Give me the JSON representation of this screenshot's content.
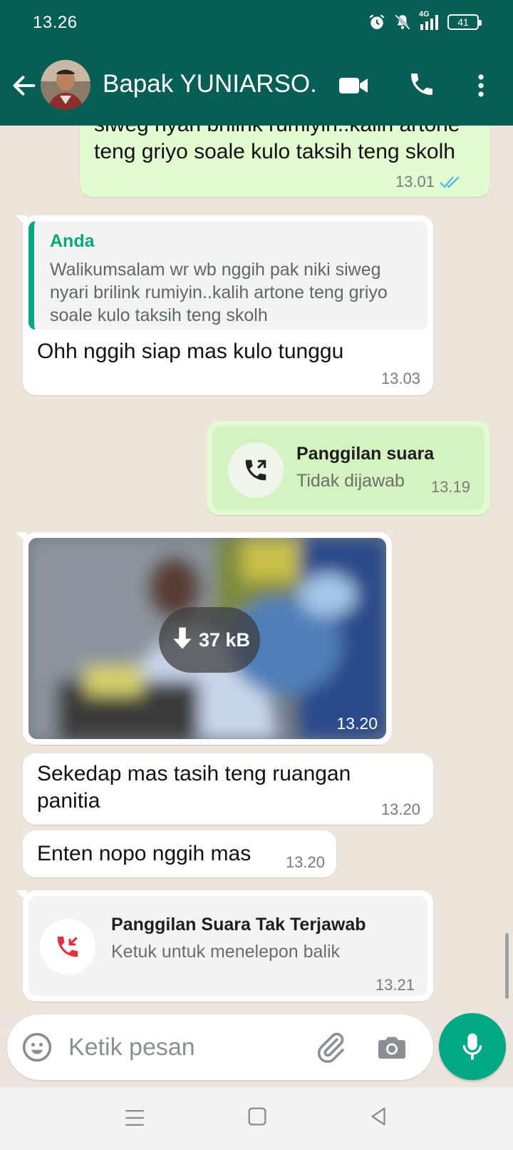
{
  "status_bar": {
    "time": "13.26",
    "network": "4G",
    "battery": "41",
    "icons": [
      "alarm-icon",
      "mute-icon",
      "signal-icon",
      "battery-icon"
    ]
  },
  "header": {
    "contact_name": "Bapak YUNIARSO...",
    "actions": [
      "back-arrow-icon",
      "video-call-icon",
      "phone-icon",
      "more-vert-icon"
    ]
  },
  "colors": {
    "header": "#075e54",
    "outgoing_bubble": "#e2fbd1",
    "incoming_bubble": "#ffffff",
    "accent": "#00a884",
    "missed_call": "#e0323c",
    "read_ticks": "#53bdeb"
  },
  "messages": [
    {
      "direction": "out",
      "text": "siweg nyari brilink rumiyin..kalih artone teng griyo soale kulo taksih teng skolh",
      "time": "13.01",
      "status": "read"
    },
    {
      "direction": "in",
      "quote_author": "Anda",
      "quote_text": "Walikumsalam wr wb nggih pak niki siweg nyari brilink rumiyin..kalih artone teng griyo soale kulo taksih teng skolh",
      "text": "Ohh nggih siap mas kulo tunggu",
      "time": "13.03"
    },
    {
      "direction": "out",
      "call_title": "Panggilan suara",
      "call_status": "Tidak dijawab",
      "time": "13.19"
    },
    {
      "direction": "in",
      "type": "image",
      "download_size": "37 kB",
      "time": "13.20"
    },
    {
      "direction": "in",
      "text": "Sekedap mas tasih teng ruangan panitia",
      "time": "13.20"
    },
    {
      "direction": "in",
      "text": "Enten nopo nggih mas",
      "time": "13.20"
    },
    {
      "direction": "in",
      "call_title": "Panggilan Suara Tak Terjawab",
      "call_status": "Ketuk untuk menelepon balik",
      "time": "13.21"
    }
  ],
  "input": {
    "placeholder": "Ketik pesan",
    "icons": [
      "emoji-icon",
      "attach-icon",
      "camera-icon",
      "mic-icon"
    ]
  },
  "nav": [
    "menu-icon",
    "home-icon",
    "back-icon"
  ]
}
